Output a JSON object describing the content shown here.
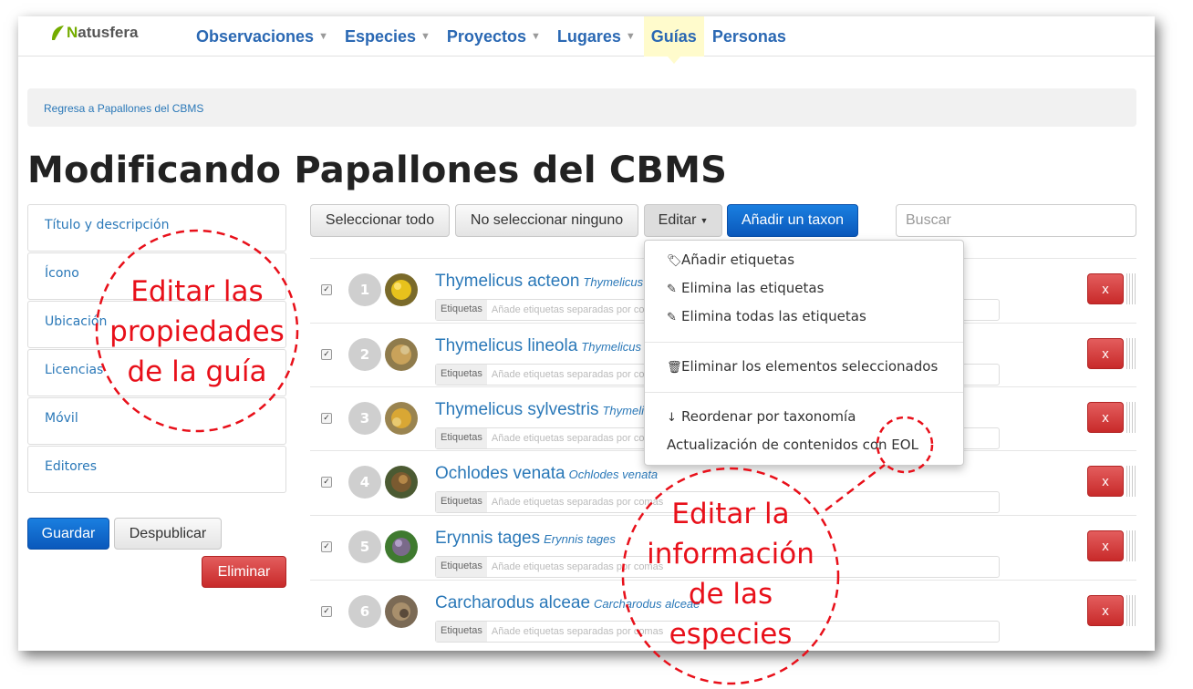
{
  "brand": {
    "logo_first": "N",
    "logo_rest": "atusfera"
  },
  "nav": {
    "items": [
      {
        "label": "Observaciones",
        "caret": true
      },
      {
        "label": "Especies",
        "caret": true
      },
      {
        "label": "Proyectos",
        "caret": true
      },
      {
        "label": "Lugares",
        "caret": true
      },
      {
        "label": "Guías",
        "caret": false,
        "active": true
      },
      {
        "label": "Personas",
        "caret": false
      }
    ]
  },
  "breadcrumb": "Regresa a Papallones del CBMS",
  "page_title": "Modificando Papallones del CBMS",
  "sidebar": {
    "items": [
      {
        "label": "Título y descripción"
      },
      {
        "label": "Ícono"
      },
      {
        "label": "Ubicación"
      },
      {
        "label": "Licencias"
      },
      {
        "label": "Móvil"
      },
      {
        "label": "Editores"
      }
    ],
    "save_label": "Guardar",
    "unpublish_label": "Despublicar",
    "delete_label": "Eliminar"
  },
  "toolbar": {
    "select_all": "Seleccionar todo",
    "select_none": "No seleccionar ninguno",
    "edit": "Editar",
    "add_taxon": "Añadir un taxon",
    "search_placeholder": "Buscar"
  },
  "edit_menu": {
    "add_tags": "Añadir etiquetas",
    "remove_tags": "Elimina las etiquetas",
    "remove_all_tags": "Elimina todas las etiquetas",
    "remove_selected": "Eliminar los elementos seleccionados",
    "reorder": "Reordenar por taxonomía",
    "update_eol": "Actualización de contenidos con EOL"
  },
  "rows": [
    {
      "num": "1",
      "common": "Thymelicus acteon",
      "sci": "Thymelicus acteon"
    },
    {
      "num": "2",
      "common": "Thymelicus lineola",
      "sci": "Thymelicus lineola"
    },
    {
      "num": "3",
      "common": "Thymelicus sylvestris",
      "sci": "Thymelicus sylvestris"
    },
    {
      "num": "4",
      "common": "Ochlodes venata",
      "sci": "Ochlodes venata"
    },
    {
      "num": "5",
      "common": "Erynnis tages",
      "sci": "Erynnis tages"
    },
    {
      "num": "6",
      "common": "Carcharodus alceae",
      "sci": "Carcharodus alceae"
    }
  ],
  "row_common": {
    "tags_label": "Etiquetas",
    "tags_placeholder": "Añade etiquetas separadas por comas",
    "remove": "x",
    "check": "✓"
  },
  "annotations": {
    "left": [
      "Editar las",
      "propiedades",
      "de la guía"
    ],
    "right": [
      "Editar la",
      "información",
      "de las",
      "especies"
    ]
  },
  "colors": {
    "link": "#2a78b8",
    "nav": "#2a68b3",
    "primary": "#0a58bb",
    "danger": "#c82a2a",
    "annotation": "#e8101a",
    "logo_green": "#74ac00"
  }
}
